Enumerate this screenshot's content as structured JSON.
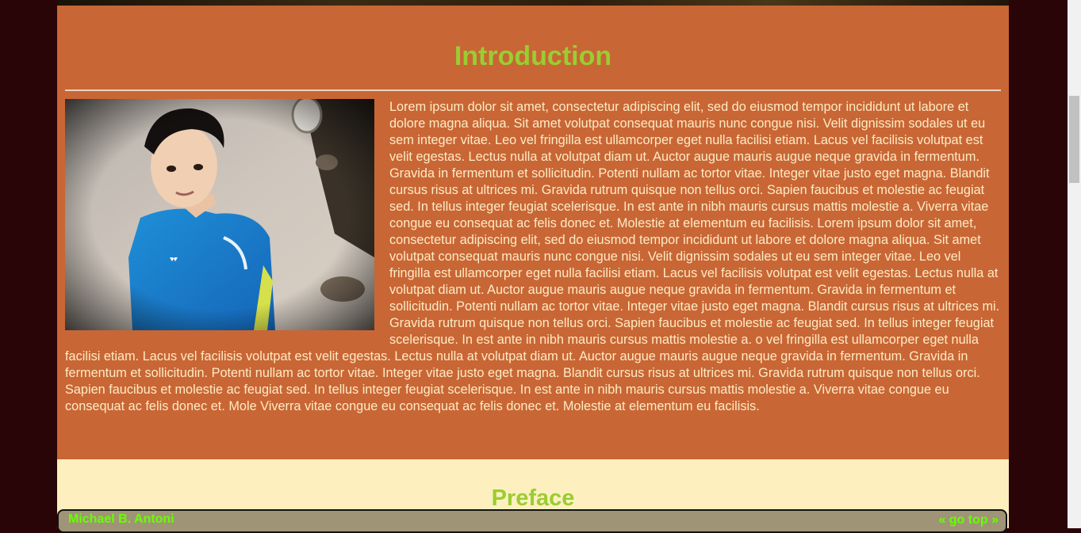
{
  "intro": {
    "title": "Introduction",
    "paragraph": "Lorem ipsum dolor sit amet, consectetur adipiscing elit, sed do eiusmod tempor incididunt ut labore et dolore magna aliqua. Sit amet volutpat consequat mauris nunc congue nisi. Velit dignissim sodales ut eu sem integer vitae. Leo vel fringilla est ullamcorper eget nulla facilisi etiam. Lacus vel facilisis volutpat est velit egestas. Lectus nulla at volutpat diam ut. Auctor augue mauris augue neque gravida in fermentum. Gravida in fermentum et sollicitudin. Potenti nullam ac tortor vitae. Integer vitae justo eget magna. Blandit cursus risus at ultrices mi. Gravida rutrum quisque non tellus orci. Sapien faucibus et molestie ac feugiat sed. In tellus integer feugiat scelerisque. In est ante in nibh mauris cursus mattis molestie a. Viverra vitae congue eu consequat ac felis donec et. Molestie at elementum eu facilisis. Lorem ipsum dolor sit amet, consectetur adipiscing elit, sed do eiusmod tempor incididunt ut labore et dolore magna aliqua. Sit amet volutpat consequat mauris nunc congue nisi. Velit dignissim sodales ut eu sem integer vitae. Leo vel fringilla est ullamcorper eget nulla facilisi etiam. Lacus vel facilisis volutpat est velit egestas. Lectus nulla at volutpat diam ut. Auctor augue mauris augue neque gravida in fermentum. Gravida in fermentum et sollicitudin. Potenti nullam ac tortor vitae. Integer vitae justo eget magna. Blandit cursus risus at ultrices mi. Gravida rutrum quisque non tellus orci. Sapien faucibus et molestie ac feugiat sed. In tellus integer feugiat scelerisque. In est ante in nibh mauris cursus mattis molestie a. o vel fringilla est ullamcorper eget nulla facilisi etiam. Lacus vel facilisis volutpat est velit egestas. Lectus nulla at volutpat diam ut. Auctor augue mauris augue neque gravida in fermentum. Gravida in fermentum et sollicitudin. Potenti nullam ac tortor vitae. Integer vitae justo eget magna. Blandit cursus risus at ultrices mi. Gravida rutrum quisque non tellus orci. Sapien faucibus et molestie ac feugiat sed. In tellus integer feugiat scelerisque. In est ante in nibh mauris cursus mattis molestie a. Viverra vitae congue eu consequat ac felis donec et. Mole Viverra vitae congue eu consequat ac felis donec et. Molestie at elementum eu facilisis."
  },
  "preface": {
    "title": "Preface"
  },
  "footer": {
    "author": "Michael B. Antoni",
    "go_top": "« go top »"
  },
  "colors": {
    "page_background": "#2a0508",
    "intro_background": "#c96635",
    "preface_background": "#fdf0be",
    "heading": "#9acd32",
    "body_text": "#fdebc4",
    "footer_background": "#a09477",
    "footer_text": "#66ff00"
  }
}
